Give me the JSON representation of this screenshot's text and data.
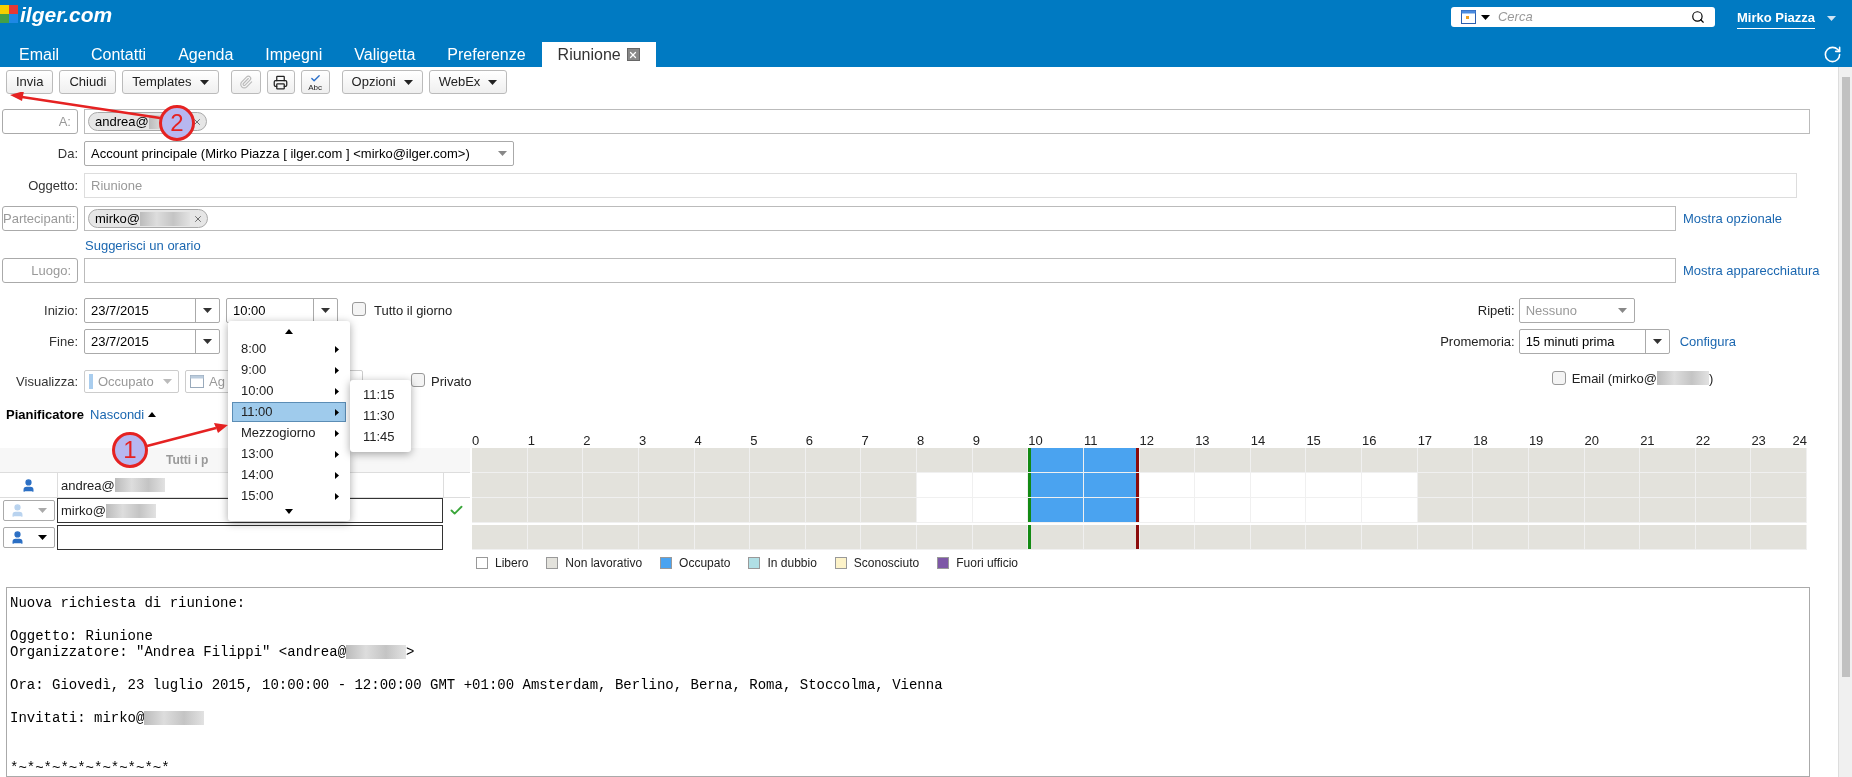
{
  "header": {
    "logo": "ilger.com",
    "search": {
      "placeholder": "Cerca"
    },
    "user": "Mirko Piazza"
  },
  "tabs": [
    {
      "label": "Email",
      "selected": false
    },
    {
      "label": "Contatti",
      "selected": false
    },
    {
      "label": "Agenda",
      "selected": false
    },
    {
      "label": "Impegni",
      "selected": false
    },
    {
      "label": "Valigetta",
      "selected": false
    },
    {
      "label": "Preferenze",
      "selected": false
    },
    {
      "label": "Riunione",
      "selected": true
    }
  ],
  "toolbar": [
    {
      "items": [
        {
          "kind": "button",
          "label": "Invia"
        },
        {
          "kind": "button",
          "label": "Chiudi"
        },
        {
          "kind": "menu",
          "label": "Templates"
        }
      ]
    },
    {
      "items": [
        {
          "kind": "attach",
          "disabled": true
        },
        {
          "kind": "print",
          "disabled": false
        },
        {
          "kind": "spellcheck",
          "label": "Abc",
          "disabled": false
        }
      ]
    },
    {
      "items": [
        {
          "kind": "menu",
          "label": "Opzioni"
        },
        {
          "kind": "menu",
          "label": "WebEx"
        }
      ]
    }
  ],
  "form": {
    "to": {
      "label": "A:",
      "recipients": [
        {
          "text": "andrea@"
        }
      ]
    },
    "from": {
      "label": "Da:",
      "value": "Account principale (Mirko Piazza [ ilger.com ] <mirko@ilger.com>)"
    },
    "subject": {
      "label": "Oggetto:",
      "placeholder": "Riunione"
    },
    "attendees": {
      "label": "Partecipanti:",
      "recipients": [
        {
          "text": "mirko@"
        }
      ],
      "link": "Mostra opzionale"
    },
    "suggest_link": "Suggerisci un orario",
    "location": {
      "label": "Luogo:",
      "link": "Mostra apparecchiatura"
    },
    "start": {
      "label": "Inizio:",
      "date": "23/7/2015",
      "time": "10:00"
    },
    "all_day": {
      "label": "Tutto il giorno",
      "checked": false
    },
    "end": {
      "label": "Fine:",
      "date": "23/7/2015"
    },
    "show_as": {
      "label": "Visualizza:",
      "value": "Occupato",
      "calendar": "Ag",
      "disabled": true
    },
    "private": {
      "label": "Privato",
      "checked": false
    },
    "repeat": {
      "label": "Ripeti:",
      "value": "Nessuno",
      "disabled": true
    },
    "reminder": {
      "label": "Promemoria:",
      "value": "15 minuti prima",
      "link": "Configura"
    },
    "email_reminder": {
      "label": "Email (mirko@",
      "suffix": ")",
      "checked": false
    }
  },
  "scheduler": {
    "title": "Pianificatore",
    "toggle": "Nascondi",
    "hours": [
      {
        "label": "0"
      },
      {
        "label": "1"
      },
      {
        "label": "2"
      },
      {
        "label": "3"
      },
      {
        "label": "4"
      },
      {
        "label": "5"
      },
      {
        "label": "6"
      },
      {
        "label": "7"
      },
      {
        "label": "8"
      },
      {
        "label": "9"
      },
      {
        "label": "10",
        "meeting": true
      },
      {
        "label": "11",
        "meeting": true
      },
      {
        "label": "12"
      },
      {
        "label": "13"
      },
      {
        "label": "14"
      },
      {
        "label": "15"
      },
      {
        "label": "16"
      },
      {
        "label": "17"
      },
      {
        "label": "18"
      },
      {
        "label": "19"
      },
      {
        "label": "20"
      },
      {
        "label": "21"
      },
      {
        "label": "22"
      },
      {
        "label": "23"
      },
      {
        "label": "24"
      }
    ],
    "rows": [
      {
        "kind": "all",
        "label": "Tutti i p",
        "slots": [
          {
            "working": false,
            "busy": false
          },
          {
            "working": false,
            "busy": false
          },
          {
            "working": false,
            "busy": false
          },
          {
            "working": false,
            "busy": false
          },
          {
            "working": false,
            "busy": false
          },
          {
            "working": false,
            "busy": false
          },
          {
            "working": false,
            "busy": false
          },
          {
            "working": false,
            "busy": false
          },
          {
            "working": false,
            "busy": false
          },
          {
            "working": false,
            "busy": false
          },
          {
            "busy": true
          },
          {
            "busy": true
          },
          {
            "working": false,
            "busy": false
          },
          {
            "working": false,
            "busy": false
          },
          {
            "working": false,
            "busy": false
          },
          {
            "working": false,
            "busy": false
          },
          {
            "working": false,
            "busy": false
          },
          {
            "working": false,
            "busy": false
          },
          {
            "working": false,
            "busy": false
          },
          {
            "working": false,
            "busy": false
          },
          {
            "working": false,
            "busy": false
          },
          {
            "working": false,
            "busy": false
          },
          {
            "working": false,
            "busy": false
          },
          {
            "working": false,
            "busy": false
          }
        ]
      },
      {
        "kind": "organizer",
        "name": "andrea@",
        "slots": [
          {
            "working": false,
            "busy": false
          },
          {
            "working": false,
            "busy": false
          },
          {
            "working": false,
            "busy": false
          },
          {
            "working": false,
            "busy": false
          },
          {
            "working": false,
            "busy": false
          },
          {
            "working": false,
            "busy": false
          },
          {
            "working": false,
            "busy": false
          },
          {
            "working": false,
            "busy": false
          },
          {
            "working": true,
            "busy": false
          },
          {
            "working": true,
            "busy": false
          },
          {
            "busy": true
          },
          {
            "busy": true
          },
          {
            "working": true,
            "busy": false
          },
          {
            "working": true,
            "busy": false
          },
          {
            "working": true,
            "busy": false
          },
          {
            "working": true,
            "busy": false
          },
          {
            "working": true,
            "busy": false
          },
          {
            "working": false,
            "busy": false
          },
          {
            "working": false,
            "busy": false
          },
          {
            "working": false,
            "busy": false
          },
          {
            "working": false,
            "busy": false
          },
          {
            "working": false,
            "busy": false
          },
          {
            "working": false,
            "busy": false
          },
          {
            "working": false,
            "busy": false
          }
        ]
      },
      {
        "kind": "attendee",
        "name": "mirko@",
        "available": true,
        "slots": [
          {
            "working": false,
            "busy": false
          },
          {
            "working": false,
            "busy": false
          },
          {
            "working": false,
            "busy": false
          },
          {
            "working": false,
            "busy": false
          },
          {
            "working": false,
            "busy": false
          },
          {
            "working": false,
            "busy": false
          },
          {
            "working": false,
            "busy": false
          },
          {
            "working": false,
            "busy": false
          },
          {
            "working": true,
            "busy": false
          },
          {
            "working": true,
            "busy": false
          },
          {
            "busy": true
          },
          {
            "busy": true
          },
          {
            "working": true,
            "busy": false
          },
          {
            "working": true,
            "busy": false
          },
          {
            "working": true,
            "busy": false
          },
          {
            "working": true,
            "busy": false
          },
          {
            "working": true,
            "busy": false
          },
          {
            "working": false,
            "busy": false
          },
          {
            "working": false,
            "busy": false
          },
          {
            "working": false,
            "busy": false
          },
          {
            "working": false,
            "busy": false
          },
          {
            "working": false,
            "busy": false
          },
          {
            "working": false,
            "busy": false
          },
          {
            "working": false,
            "busy": false
          }
        ]
      },
      {
        "kind": "new",
        "slots": [
          {
            "working": false,
            "busy": false
          },
          {
            "working": false,
            "busy": false
          },
          {
            "working": false,
            "busy": false
          },
          {
            "working": false,
            "busy": false
          },
          {
            "working": false,
            "busy": false
          },
          {
            "working": false,
            "busy": false
          },
          {
            "working": false,
            "busy": false
          },
          {
            "working": false,
            "busy": false
          },
          {
            "working": false,
            "busy": false
          },
          {
            "working": false,
            "busy": false
          },
          {
            "working": false,
            "busy": false
          },
          {
            "working": false,
            "busy": false
          },
          {
            "working": false,
            "busy": false
          },
          {
            "working": false,
            "busy": false
          },
          {
            "working": false,
            "busy": false
          },
          {
            "working": false,
            "busy": false
          },
          {
            "working": false,
            "busy": false
          },
          {
            "working": false,
            "busy": false
          },
          {
            "working": false,
            "busy": false
          },
          {
            "working": false,
            "busy": false
          },
          {
            "working": false,
            "busy": false
          },
          {
            "working": false,
            "busy": false
          },
          {
            "working": false,
            "busy": false
          },
          {
            "working": false,
            "busy": false
          }
        ]
      }
    ],
    "legend": [
      {
        "label": "Libero",
        "color": "#ffffff"
      },
      {
        "label": "Non lavorativo",
        "color": "#e3e2dc"
      },
      {
        "label": "Occupato",
        "color": "#4aa3f0"
      },
      {
        "label": "In dubbio",
        "color": "#b0dfe5"
      },
      {
        "label": "Sconosciuto",
        "color": "#fdf3c9"
      },
      {
        "label": "Fuori ufficio",
        "color": "#7d57a6"
      }
    ]
  },
  "time_menu": {
    "items": [
      {
        "label": "8:00",
        "selected": false
      },
      {
        "label": "9:00",
        "selected": false
      },
      {
        "label": "10:00",
        "selected": false
      },
      {
        "label": "11:00",
        "selected": true
      },
      {
        "label": "Mezzogiorno",
        "selected": false
      },
      {
        "label": "13:00",
        "selected": false
      },
      {
        "label": "14:00",
        "selected": false
      },
      {
        "label": "15:00",
        "selected": false
      }
    ],
    "submenu": [
      "11:15",
      "11:30",
      "11:45"
    ]
  },
  "body": {
    "lines": [
      {
        "kind": "text",
        "text": "Nuova richiesta di riunione:"
      },
      {
        "kind": "gap"
      },
      {
        "kind": "text",
        "text": "Oggetto: Riunione"
      },
      {
        "kind": "redacted",
        "text": "Organizzatore: \"Andrea Filippi\" <andrea@",
        "suffix": ">"
      },
      {
        "kind": "gap"
      },
      {
        "kind": "text",
        "text": "Ora: Giovedì, 23 luglio 2015, 10:00:00 - 12:00:00 GMT +01:00 Amsterdam, Berlino, Berna, Roma, Stoccolma, Vienna"
      },
      {
        "kind": "gap"
      },
      {
        "kind": "redacted",
        "text": "Invitati: mirko@"
      },
      {
        "kind": "gap"
      },
      {
        "kind": "gap"
      },
      {
        "kind": "text",
        "text": "*~*~*~*~*~*~*~*~*~*"
      }
    ]
  },
  "annotations": [
    {
      "label": "1"
    },
    {
      "label": "2"
    }
  ]
}
